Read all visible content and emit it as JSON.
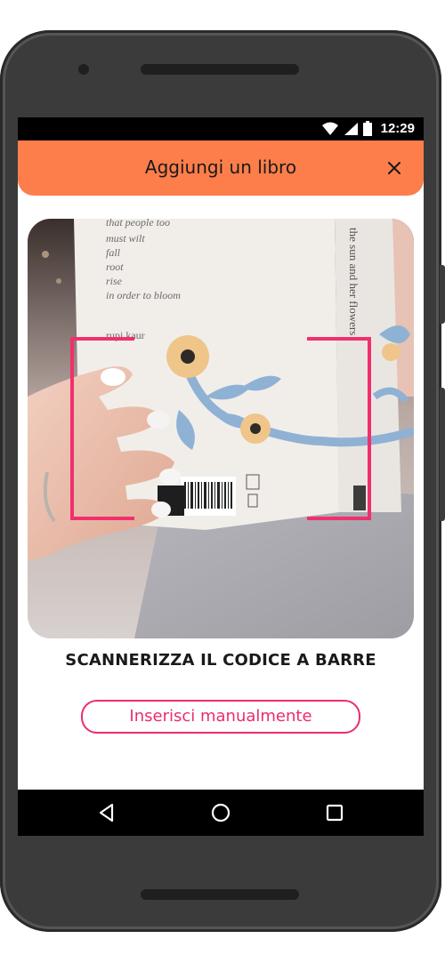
{
  "status_bar": {
    "time": "12:29",
    "icons": [
      "wifi-icon",
      "signal-icon",
      "battery-icon"
    ]
  },
  "header": {
    "title": "Aggiungi un libro",
    "close_icon": "close-icon",
    "background": "#fd7e4b"
  },
  "scanner": {
    "frame_color": "#f0306e",
    "book_text": {
      "poem_lines": [
        "that people too",
        "must wilt",
        "fall",
        "root",
        "rise",
        "in order to bloom"
      ],
      "author": "rupi kaur",
      "spine_title": "the sun and her flowers"
    }
  },
  "main": {
    "scan_label": "SCANNERIZZA IL CODICE A BARRE",
    "manual_button_label": "Inserisci manualmente",
    "accent": "#ec2d6a"
  },
  "nav_bar": {
    "icons": [
      "back-icon",
      "home-icon",
      "recents-icon"
    ]
  }
}
